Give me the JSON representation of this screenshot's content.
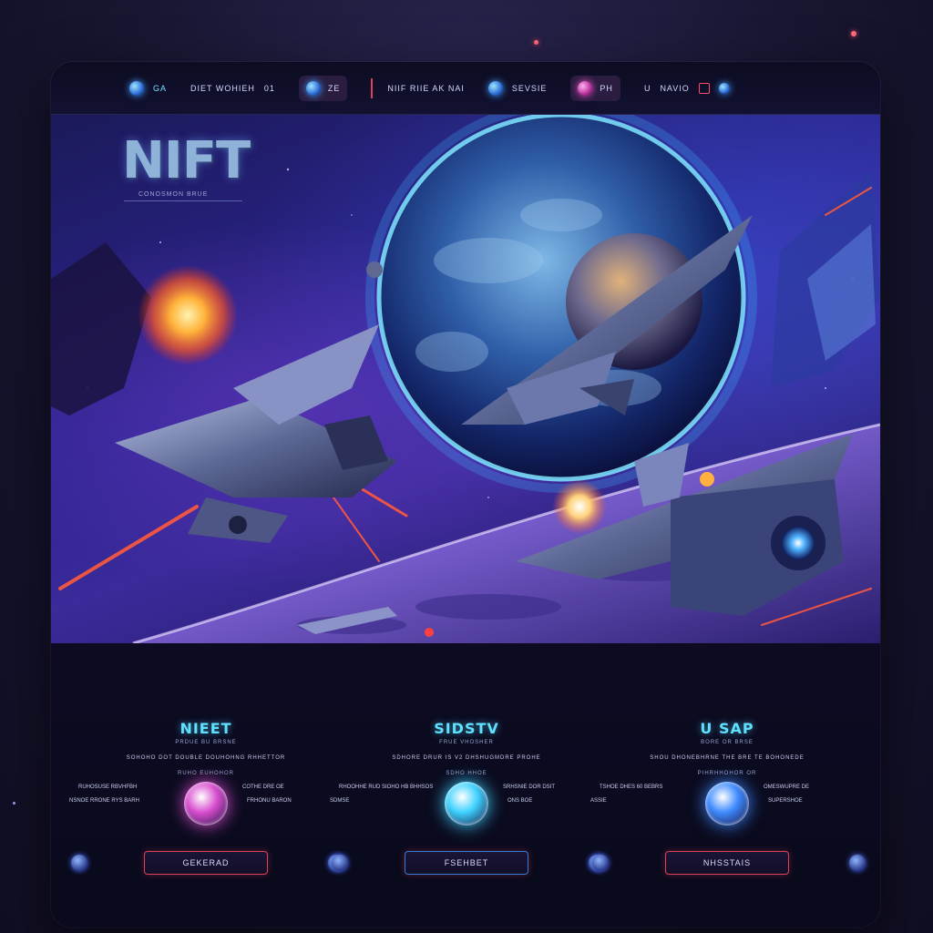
{
  "nav": {
    "items": [
      {
        "label": "GA",
        "icon": "planet-icon"
      },
      {
        "label": "DIET WOHIEH"
      },
      {
        "label": "01"
      },
      {
        "label": "ZE",
        "icon": "planet-icon"
      },
      {
        "label": "NIIF RIIE AK NAI"
      },
      {
        "label": "SEVSIE",
        "icon": "planet-icon"
      },
      {
        "label": "PH",
        "icon": "planet-pink-icon"
      },
      {
        "label": "U"
      },
      {
        "label": "NAVIO"
      }
    ]
  },
  "hero": {
    "title": "NIFT",
    "subtitle": "CONOSMON BRUE"
  },
  "sections": [
    {
      "title": "NIEET",
      "line1": "PRDUE BU BRSNE",
      "line2": "SOHOHO DOT DOUBLE DOUHOHNG RHHETTOR",
      "line3": "RUHO EUHOHOR",
      "left_label_1": "RUHOSUSE RBVHFBH",
      "left_label_2": "NSNOE RRONE RYS BARH",
      "right_label_1": "COTHE DRE OE",
      "right_label_2": "FRHONU BARON",
      "button_label": "GEKERAD",
      "orb_color": "#d94fd0"
    },
    {
      "title": "SIDSTV",
      "line1": "FRUE VHOSHER",
      "line2": "SDHORE DRUR IS V2 DHSHUGMDRE PROHE",
      "line3": "SDHO HHOE",
      "left_label_1": "RHOOHHE RUD SIOHO HB BHHSOS",
      "left_label_2": "SDMSE",
      "right_label_1": "SRHSNIE DOR DSIT",
      "right_label_2": "ONS BOE",
      "button_label": "FSEHBET",
      "orb_color": "#3fd2ff"
    },
    {
      "title": "U SAP",
      "line1": "BORE OR BRSE",
      "line2": "SHOU DHONEBHRNE THE BRE TE BOHONEDE",
      "line3": "PIHRHHOHOR OR",
      "left_label_1": "TSHOE DHES 60 BEBRS",
      "left_label_2": "ASSIE",
      "right_label_1": "OMESWUPRE DE",
      "right_label_2": "SUPERSHOE",
      "button_label": "NHSSTAIS",
      "orb_color": "#3f8bff"
    }
  ],
  "colors": {
    "accent_cyan": "#5fe0ff",
    "accent_red": "#e0405a",
    "panel_bg": "#0b0a1e"
  }
}
